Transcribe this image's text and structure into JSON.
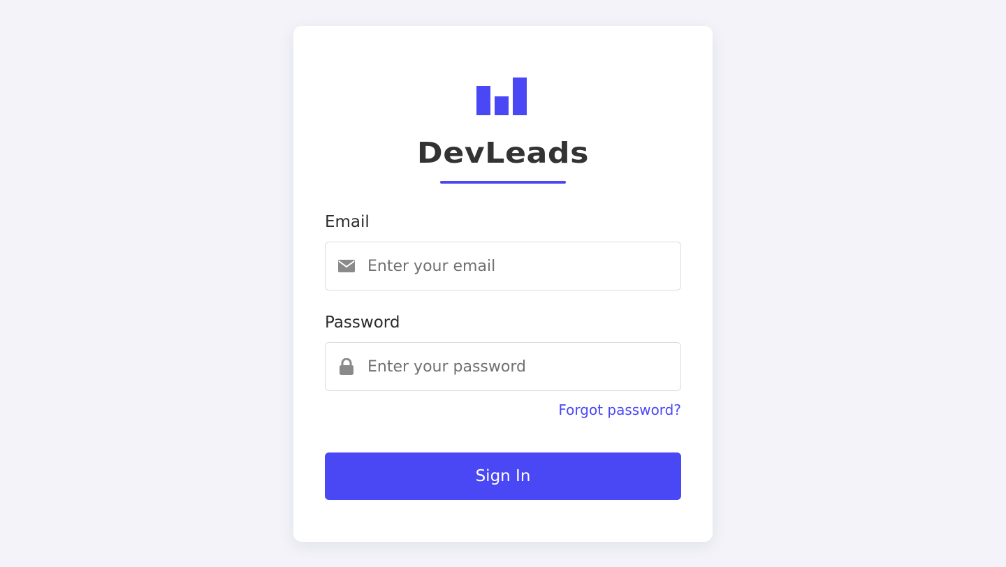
{
  "brand": {
    "name": "DevLeads",
    "logo_icon": "bar-chart-icon"
  },
  "form": {
    "email": {
      "label": "Email",
      "placeholder": "Enter your email",
      "value": "",
      "icon": "envelope-icon"
    },
    "password": {
      "label": "Password",
      "placeholder": "Enter your password",
      "value": "",
      "icon": "lock-icon"
    },
    "forgot_password": "Forgot password?",
    "submit_label": "Sign In"
  },
  "colors": {
    "accent": "#4a47f5",
    "background": "#f3f3f9",
    "card": "#ffffff",
    "text_dark": "#333333",
    "icon_gray": "#8a8a8a"
  }
}
